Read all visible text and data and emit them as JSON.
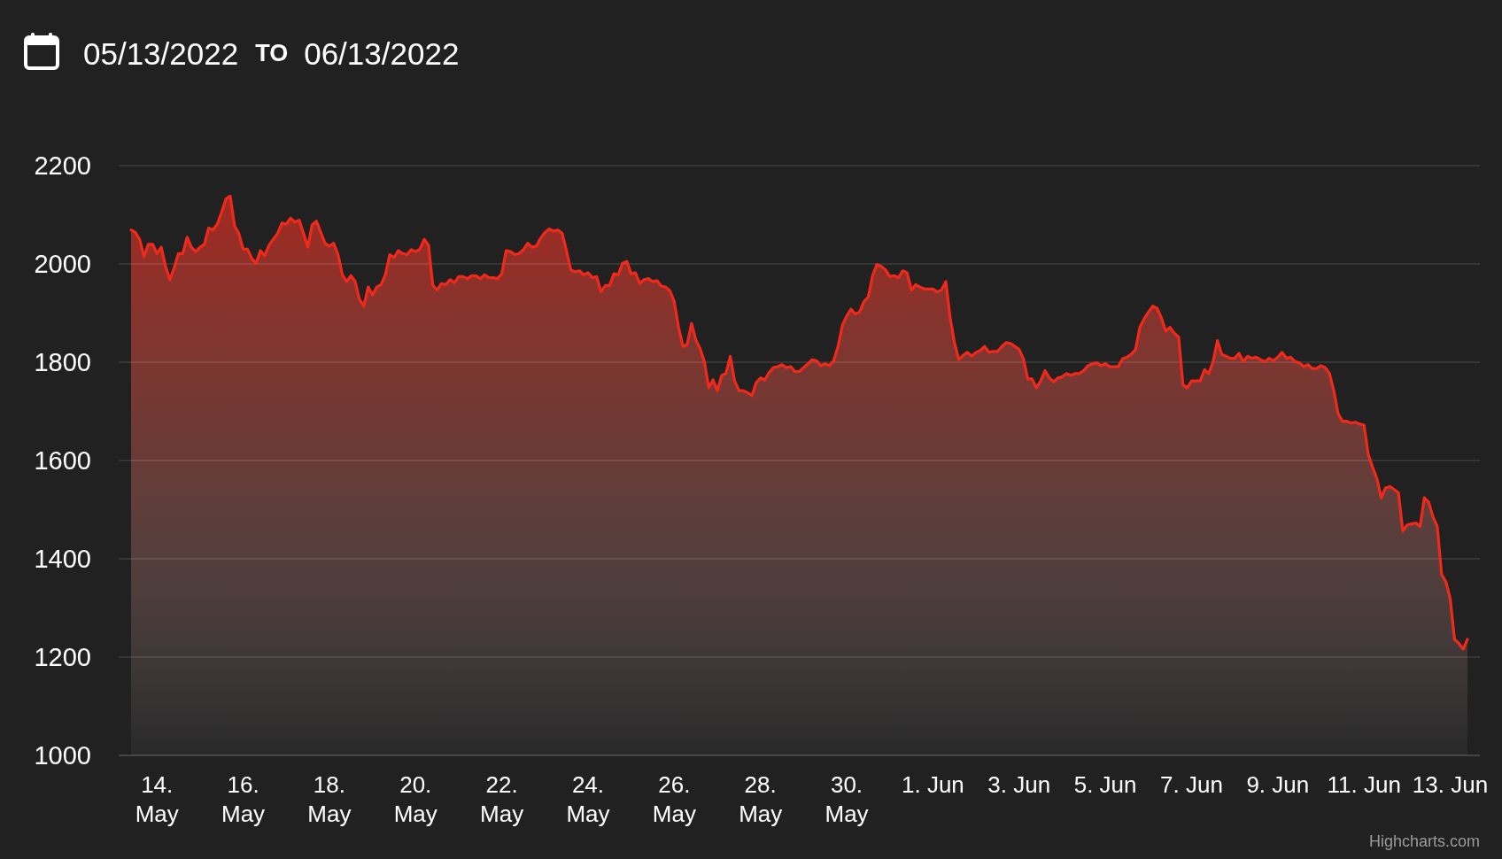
{
  "date_range": {
    "start": "05/13/2022",
    "separator": "TO",
    "end": "06/13/2022"
  },
  "chart": {
    "chart_data": {
      "type": "area",
      "categories": [
        null,
        null,
        null,
        null,
        null,
        null,
        "14. May",
        null,
        null,
        null,
        null,
        null,
        null,
        null,
        null,
        null,
        null,
        null,
        null,
        null,
        null,
        null,
        null,
        null,
        null,
        null,
        "16. May",
        null,
        null,
        null,
        null,
        null,
        null,
        null,
        null,
        null,
        null,
        null,
        null,
        null,
        null,
        null,
        null,
        null,
        null,
        null,
        "18. May",
        null,
        null,
        null,
        null,
        null,
        null,
        null,
        null,
        null,
        null,
        null,
        null,
        null,
        null,
        null,
        null,
        null,
        null,
        null,
        "20. May",
        null,
        null,
        null,
        null,
        null,
        null,
        null,
        null,
        null,
        null,
        null,
        null,
        null,
        null,
        null,
        null,
        null,
        null,
        null,
        "22. May",
        null,
        null,
        null,
        null,
        null,
        null,
        null,
        null,
        null,
        null,
        null,
        null,
        null,
        null,
        null,
        null,
        null,
        null,
        null,
        "24. May",
        null,
        null,
        null,
        null,
        null,
        null,
        null,
        null,
        null,
        null,
        null,
        null,
        null,
        null,
        null,
        null,
        null,
        null,
        null,
        "26. May",
        null,
        null,
        null,
        null,
        null,
        null,
        null,
        null,
        null,
        null,
        null,
        null,
        null,
        null,
        null,
        null,
        null,
        null,
        null,
        "28. May",
        null,
        null,
        null,
        null,
        null,
        null,
        null,
        null,
        null,
        null,
        null,
        null,
        null,
        null,
        null,
        null,
        null,
        null,
        null,
        "30. May",
        null,
        null,
        null,
        null,
        null,
        null,
        null,
        null,
        null,
        null,
        null,
        null,
        null,
        null,
        null,
        null,
        null,
        null,
        null,
        "1. Jun",
        null,
        null,
        null,
        null,
        null,
        null,
        null,
        null,
        null,
        null,
        null,
        null,
        null,
        null,
        null,
        null,
        null,
        null,
        null,
        "3. Jun",
        null,
        null,
        null,
        null,
        null,
        null,
        null,
        null,
        null,
        null,
        null,
        null,
        null,
        null,
        null,
        null,
        null,
        null,
        null,
        "5. Jun",
        null,
        null,
        null,
        null,
        null,
        null,
        null,
        null,
        null,
        null,
        null,
        null,
        null,
        null,
        null,
        null,
        null,
        null,
        null,
        "7. Jun",
        null,
        null,
        null,
        null,
        null,
        null,
        null,
        null,
        null,
        null,
        null,
        null,
        null,
        null,
        null,
        null,
        null,
        null,
        null,
        "9. Jun",
        null,
        null,
        null,
        null,
        null,
        null,
        null,
        null,
        null,
        null,
        null,
        null,
        null,
        null,
        null,
        null,
        null,
        null,
        null,
        "11. Jun",
        null,
        null,
        null,
        null,
        null,
        null,
        null,
        null,
        null,
        null,
        null,
        null,
        null,
        null,
        null,
        null,
        null,
        null,
        null,
        "13. Jun",
        null,
        null,
        null,
        null
      ],
      "series": [
        {
          "color": "#f0291b",
          "values": [
            2069,
            2064,
            2050,
            2015,
            2040,
            2040,
            2021,
            2034,
            1995,
            1968,
            1992,
            2021,
            2021,
            2054,
            2034,
            2025,
            2034,
            2040,
            2073,
            2069,
            2081,
            2105,
            2132,
            2138,
            2077,
            2062,
            2030,
            2030,
            2011,
            2001,
            2027,
            2017,
            2038,
            2050,
            2062,
            2083,
            2081,
            2093,
            2085,
            2089,
            2062,
            2034,
            2079,
            2087,
            2064,
            2042,
            2036,
            2042,
            2019,
            1978,
            1964,
            1976,
            1964,
            1927,
            1914,
            1953,
            1937,
            1953,
            1958,
            1978,
            2019,
            2013,
            2027,
            2021,
            2019,
            2029,
            2025,
            2030,
            2050,
            2038,
            1956,
            1947,
            1960,
            1958,
            1968,
            1962,
            1974,
            1974,
            1970,
            1976,
            1976,
            1970,
            1978,
            1972,
            1972,
            1970,
            1980,
            2027,
            2025,
            2019,
            2021,
            2029,
            2042,
            2034,
            2036,
            2052,
            2064,
            2071,
            2067,
            2069,
            2062,
            2027,
            1988,
            1984,
            1986,
            1978,
            1982,
            1972,
            1974,
            1943,
            1956,
            1956,
            1980,
            1978,
            2001,
            2005,
            1980,
            1982,
            1960,
            1968,
            1970,
            1964,
            1966,
            1955,
            1953,
            1945,
            1923,
            1871,
            1832,
            1836,
            1879,
            1845,
            1828,
            1801,
            1748,
            1764,
            1742,
            1773,
            1777,
            1812,
            1762,
            1742,
            1742,
            1738,
            1732,
            1758,
            1768,
            1764,
            1779,
            1789,
            1791,
            1795,
            1789,
            1791,
            1781,
            1781,
            1789,
            1797,
            1805,
            1803,
            1793,
            1797,
            1793,
            1803,
            1832,
            1875,
            1894,
            1908,
            1898,
            1902,
            1923,
            1933,
            1976,
            1999,
            1995,
            1988,
            1974,
            1976,
            1972,
            1986,
            1982,
            1947,
            1958,
            1953,
            1949,
            1949,
            1949,
            1943,
            1947,
            1964,
            1890,
            1840,
            1805,
            1814,
            1820,
            1812,
            1820,
            1824,
            1832,
            1820,
            1822,
            1822,
            1832,
            1840,
            1838,
            1832,
            1826,
            1807,
            1766,
            1766,
            1748,
            1762,
            1783,
            1768,
            1760,
            1768,
            1770,
            1777,
            1773,
            1777,
            1777,
            1783,
            1793,
            1797,
            1799,
            1793,
            1797,
            1791,
            1791,
            1791,
            1807,
            1810,
            1816,
            1826,
            1871,
            1888,
            1902,
            1914,
            1910,
            1890,
            1863,
            1871,
            1859,
            1851,
            1754,
            1748,
            1762,
            1762,
            1762,
            1785,
            1777,
            1801,
            1844,
            1816,
            1812,
            1808,
            1808,
            1818,
            1801,
            1812,
            1808,
            1810,
            1805,
            1801,
            1808,
            1803,
            1810,
            1820,
            1808,
            1810,
            1801,
            1799,
            1791,
            1795,
            1787,
            1787,
            1793,
            1789,
            1777,
            1742,
            1695,
            1680,
            1680,
            1676,
            1678,
            1674,
            1672,
            1612,
            1586,
            1563,
            1524,
            1544,
            1547,
            1541,
            1534,
            1456,
            1469,
            1471,
            1473,
            1466,
            1524,
            1515,
            1485,
            1466,
            1368,
            1353,
            1319,
            1236,
            1228,
            1216,
            1236
          ]
        }
      ],
      "ylim": [
        1000,
        2200
      ],
      "yticks": [
        1000,
        1200,
        1400,
        1600,
        1800,
        2000,
        2200
      ],
      "grid": true
    },
    "credits": "Highcharts.com"
  }
}
